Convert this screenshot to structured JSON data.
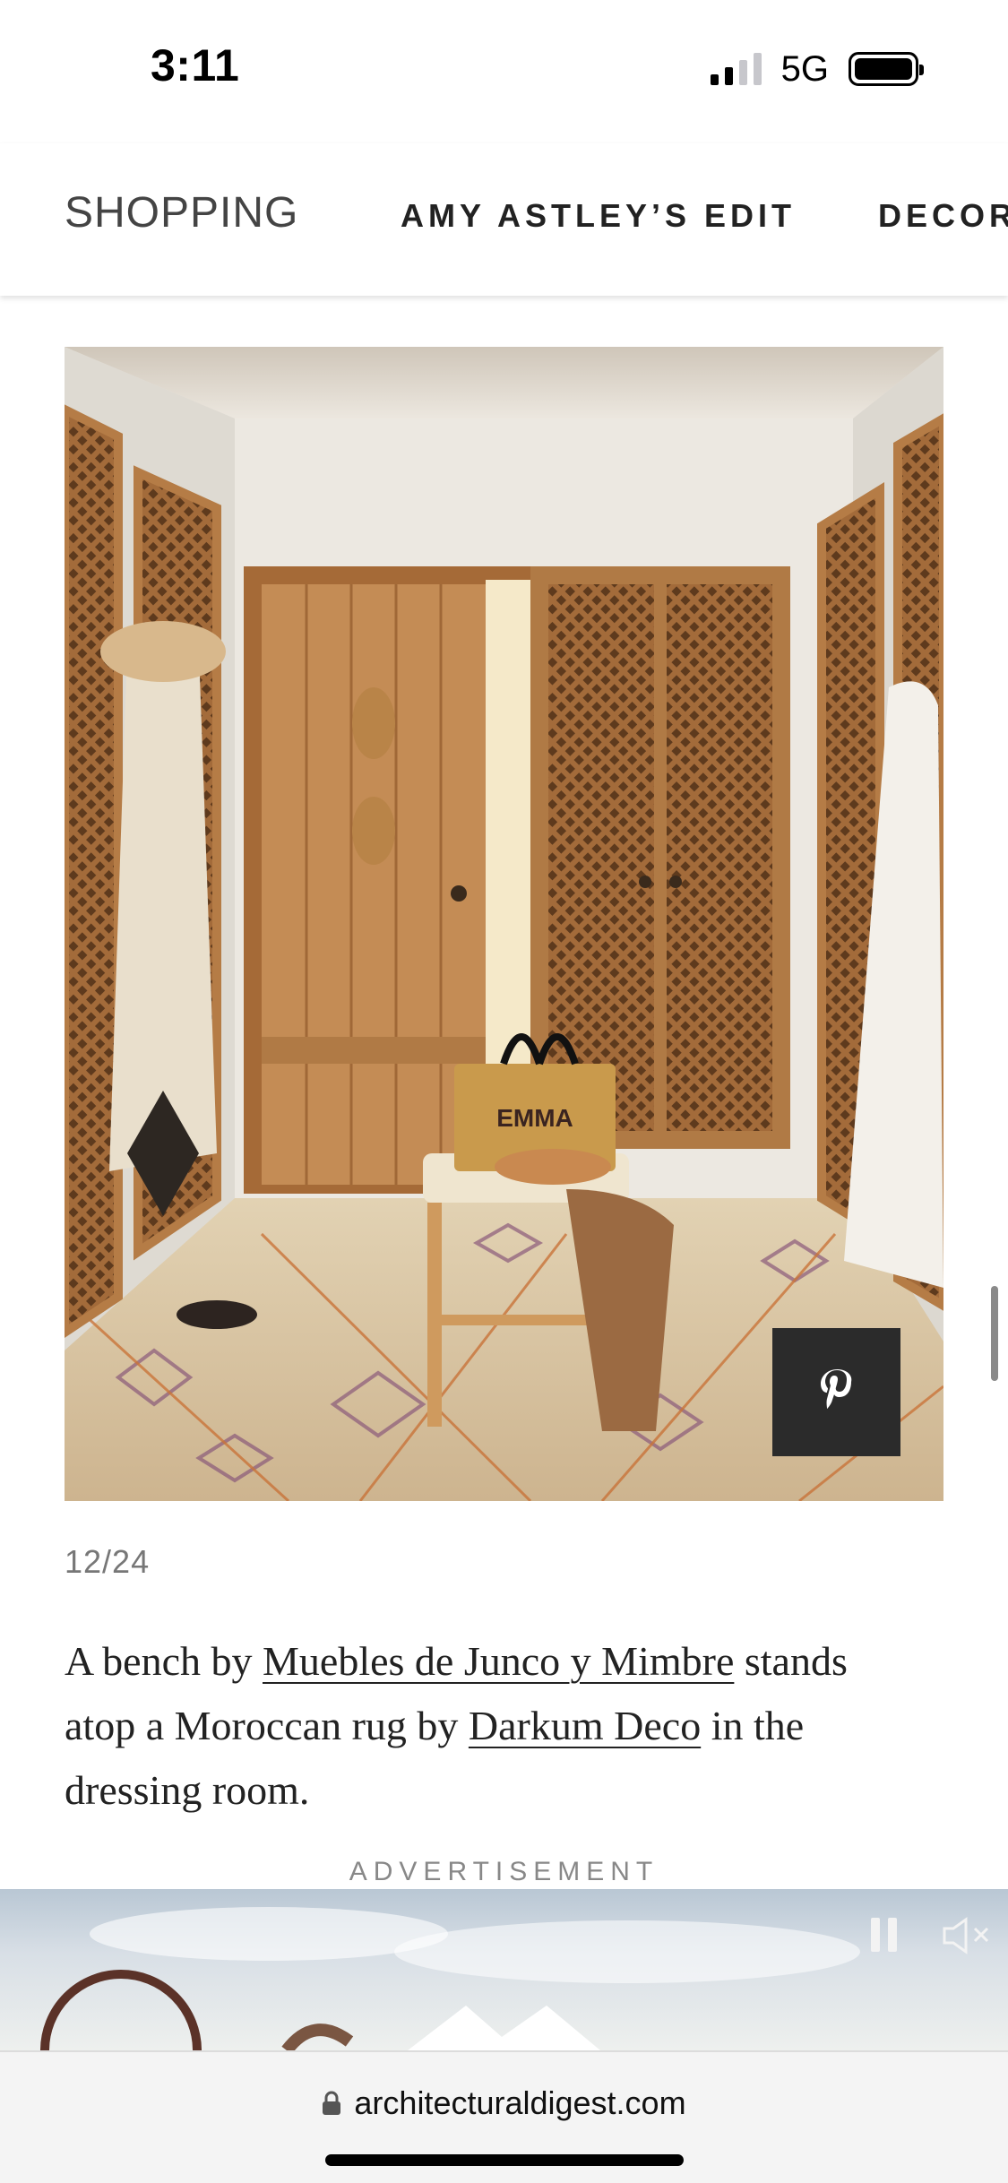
{
  "status_bar": {
    "time": "3:11",
    "network": "5G",
    "signal_bars_active": 2,
    "signal_bars_total": 4,
    "battery_level": 1.0
  },
  "nav": {
    "items": [
      {
        "label": "SHOPPING"
      },
      {
        "label": "AMY ASTLEY’S EDIT"
      },
      {
        "label": "DECOR"
      }
    ]
  },
  "gallery": {
    "image_text": "EMMA",
    "counter": "12/24",
    "pin_icon": "pinterest-icon"
  },
  "caption": {
    "part1": "A bench by ",
    "link1": "Muebles de Junco y Mimbre",
    "part2": " stands atop a Moroccan rug by ",
    "link2": "Darkum Deco",
    "part3": " in the dressing room."
  },
  "ad": {
    "label": "ADVERTISEMENT",
    "pause_icon": "pause-icon",
    "mute_icon": "mute-icon"
  },
  "browser": {
    "url": "architecturaldigest.com",
    "lock_icon": "lock-icon"
  },
  "colors": {
    "wood": "#b07a45",
    "wall": "#e7e3dc",
    "rug": "#d8c7a6",
    "pin_bg": "#2b2b2b"
  }
}
